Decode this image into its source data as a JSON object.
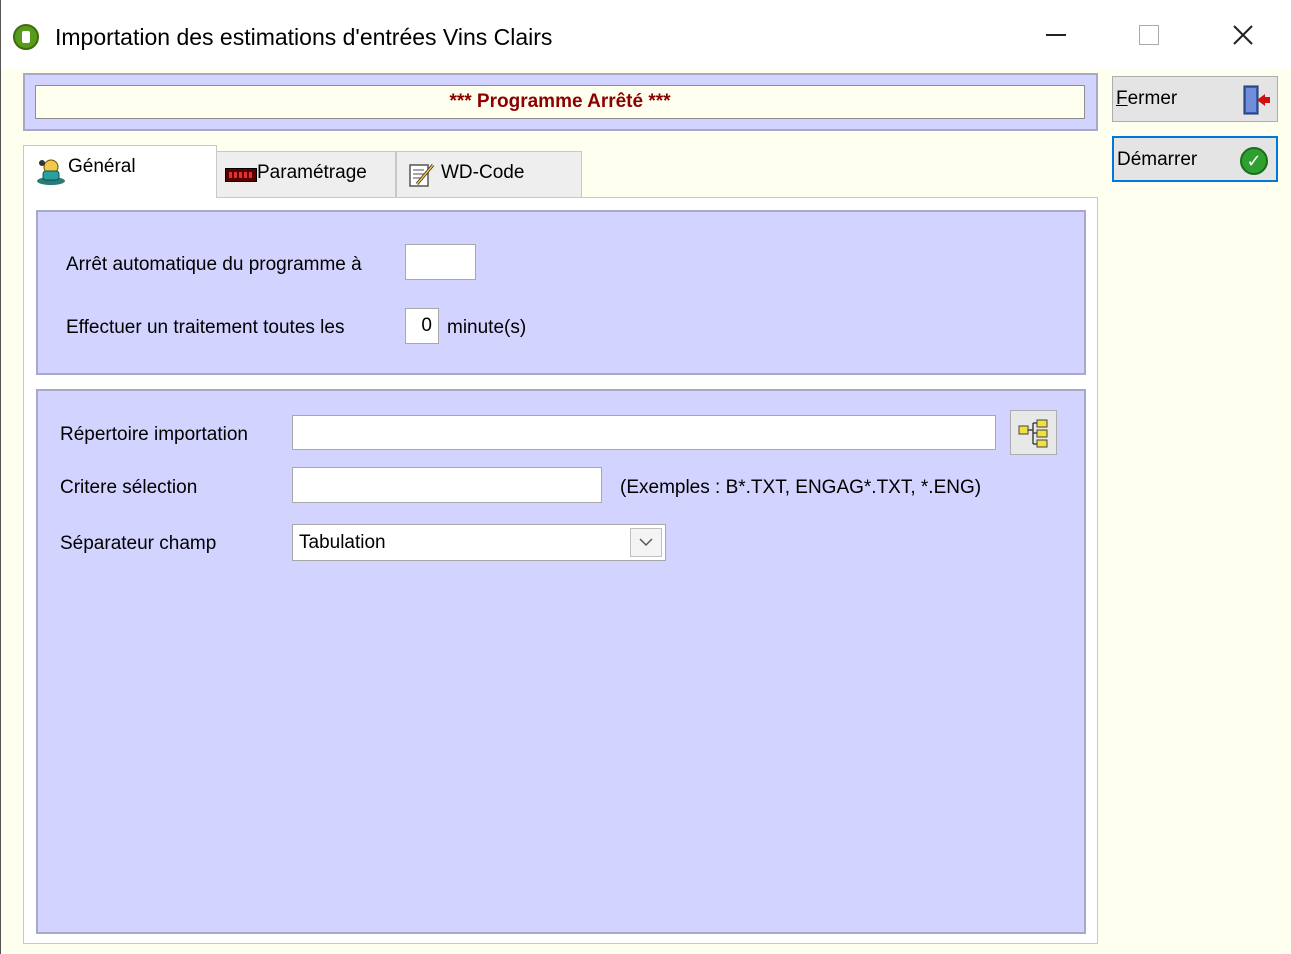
{
  "window": {
    "title": "Importation des estimations d'entrées Vins Clairs"
  },
  "status": {
    "text": "*** Programme Arrêté ***"
  },
  "buttons": {
    "fermer_first": "F",
    "fermer_rest": "ermer",
    "demarrer": "Démarrer"
  },
  "tabs": [
    {
      "label": "Général"
    },
    {
      "label": "Paramétrage"
    },
    {
      "label": "WD-Code"
    }
  ],
  "general": {
    "arret_label": "Arrêt automatique du programme à",
    "arret_value": "",
    "traitement_label": "Effectuer un traitement toutes les",
    "traitement_value": "0",
    "traitement_unit": "minute(s)",
    "repertoire_label": "Répertoire importation",
    "repertoire_value": "",
    "critere_label": "Critere sélection",
    "critere_value": "",
    "critere_hint": "(Exemples : B*.TXT, ENGAG*.TXT, *.ENG)",
    "separateur_label": "Séparateur champ",
    "separateur_value": "Tabulation"
  },
  "colors": {
    "panel": "#d3d3ff",
    "status_text": "#8b0000",
    "background": "#fffff0"
  }
}
